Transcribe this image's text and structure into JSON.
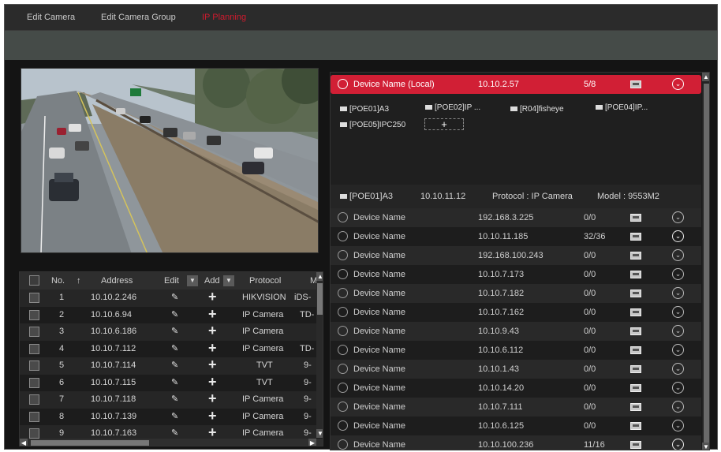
{
  "tabs": [
    {
      "label": "Edit Camera"
    },
    {
      "label": "Edit Camera Group"
    },
    {
      "label": "IP Planning",
      "active": true
    }
  ],
  "colors": {
    "accent": "#d11f35",
    "panel": "#1b1b1b",
    "toolbar": "#454b48"
  },
  "table": {
    "columns": [
      "No.",
      "Address",
      "Edit",
      "Add",
      "Protocol",
      "M"
    ],
    "rows": [
      {
        "no": "1",
        "address": "10.10.2.246",
        "protocol": "HIKVISION",
        "model": "iDS-"
      },
      {
        "no": "2",
        "address": "10.10.6.94",
        "protocol": "IP Camera",
        "model": "TD-"
      },
      {
        "no": "3",
        "address": "10.10.6.186",
        "protocol": "IP Camera",
        "model": ""
      },
      {
        "no": "4",
        "address": "10.10.7.112",
        "protocol": "IP Camera",
        "model": "TD-"
      },
      {
        "no": "5",
        "address": "10.10.7.114",
        "protocol": "TVT",
        "model": "9-"
      },
      {
        "no": "6",
        "address": "10.10.7.115",
        "protocol": "TVT",
        "model": "9-"
      },
      {
        "no": "7",
        "address": "10.10.7.118",
        "protocol": "IP Camera",
        "model": "9-"
      },
      {
        "no": "8",
        "address": "10.10.7.139",
        "protocol": "IP Camera",
        "model": "9-"
      },
      {
        "no": "9",
        "address": "10.10.7.163",
        "protocol": "IP Camera",
        "model": "9-"
      }
    ]
  },
  "local_device": {
    "name": "Device Name (Local)",
    "ip": "10.10.2.57",
    "channels": "5/8"
  },
  "cameras": [
    {
      "label": "[POE01]A3"
    },
    {
      "label": "[POE02]IP ..."
    },
    {
      "label": "[R04]fisheye"
    },
    {
      "label": "[POE04]IP..."
    },
    {
      "label": "[POE05]IPC250"
    }
  ],
  "add_camera_symbol": "+",
  "selected_camera": {
    "label": "[POE01]A3",
    "ip": "10.10.11.12",
    "protocol": "Protocol : IP Camera",
    "model": "Model : 9553M2"
  },
  "devices": [
    {
      "name": "Device Name",
      "ip": "192.168.3.225",
      "channels": "0/0"
    },
    {
      "name": "Device Name",
      "ip": "10.10.11.185",
      "channels": "32/36"
    },
    {
      "name": "Device Name",
      "ip": "192.168.100.243",
      "channels": "0/0"
    },
    {
      "name": "Device Name",
      "ip": "10.10.7.173",
      "channels": "0/0"
    },
    {
      "name": "Device Name",
      "ip": "10.10.7.182",
      "channels": "0/0"
    },
    {
      "name": "Device Name",
      "ip": "10.10.7.162",
      "channels": "0/0"
    },
    {
      "name": "Device Name",
      "ip": "10.10.9.43",
      "channels": "0/0"
    },
    {
      "name": "Device Name",
      "ip": "10.10.6.112",
      "channels": "0/0"
    },
    {
      "name": "Device Name",
      "ip": "10.10.1.43",
      "channels": "0/0"
    },
    {
      "name": "Device Name",
      "ip": "10.10.14.20",
      "channels": "0/0"
    },
    {
      "name": "Device Name",
      "ip": "10.10.7.111",
      "channels": "0/0"
    },
    {
      "name": "Device Name",
      "ip": "10.10.6.125",
      "channels": "0/0"
    },
    {
      "name": "Device Name",
      "ip": "10.10.100.236",
      "channels": "11/16"
    }
  ]
}
